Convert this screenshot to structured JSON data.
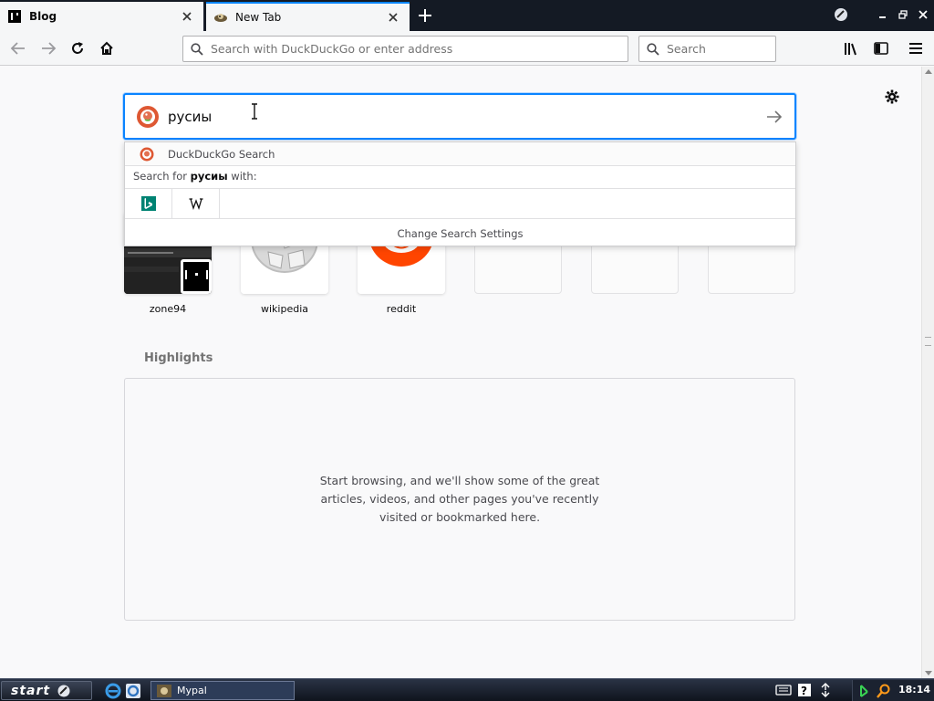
{
  "tabs": [
    {
      "label": "Blog"
    },
    {
      "label": "New Tab"
    }
  ],
  "navbar": {
    "url_placeholder": "Search with DuckDuckGo or enter address",
    "search_placeholder": "Search"
  },
  "newtab": {
    "search_value": "русиы",
    "suggestion_label": "DuckDuckGo Search",
    "search_for_prefix": "Search for ",
    "search_term": "русиы",
    "search_for_suffix": " with:",
    "change_settings": "Change Search Settings",
    "top_sites": [
      {
        "label": "zone94"
      },
      {
        "label": "wikipedia"
      },
      {
        "label": "reddit"
      }
    ],
    "highlights_title": "Highlights",
    "highlights_message": "Start browsing, and we'll show some of the great articles, videos, and other pages you've recently visited or bookmarked here."
  },
  "taskbar": {
    "start_label": "start",
    "task_label": "Mypal",
    "clock": "18:14"
  },
  "colors": {
    "accent": "#0a84ff",
    "ddg": "#de5833",
    "reddit": "#ff4500",
    "bing": "#008373"
  }
}
